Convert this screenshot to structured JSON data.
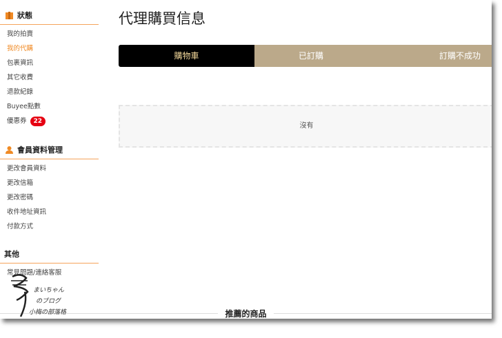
{
  "sidebar": {
    "status": {
      "title": "狀態",
      "items": [
        {
          "label": "我的拍賣"
        },
        {
          "label": "我的代購"
        },
        {
          "label": "包裹資訊"
        },
        {
          "label": "其它收費"
        },
        {
          "label": "退款紀錄"
        },
        {
          "label": "Buyee點數"
        },
        {
          "label": "優惠券",
          "badge": "22"
        }
      ]
    },
    "member": {
      "title": "會員資料管理",
      "items": [
        {
          "label": "更改會員資料"
        },
        {
          "label": "更改信箱"
        },
        {
          "label": "更改密碼"
        },
        {
          "label": "收件地址資訊"
        },
        {
          "label": "付款方式"
        }
      ]
    },
    "other": {
      "title": "其他",
      "items": [
        {
          "label": "常見問題/連絡客服"
        }
      ]
    }
  },
  "main": {
    "title": "代理購買信息",
    "tabs": [
      {
        "label": "購物車"
      },
      {
        "label": "已訂購"
      },
      {
        "label": "訂購不成功"
      }
    ],
    "empty_text": "沒有",
    "recommended_title": "推薦的商品"
  },
  "watermark": {
    "text": "まいちゃん のブログ 小梅の部落格"
  },
  "colors": {
    "accent": "#f08a24",
    "tab_active": "#000000",
    "tab_inactive": "#bba98a",
    "badge": "#e60012"
  }
}
